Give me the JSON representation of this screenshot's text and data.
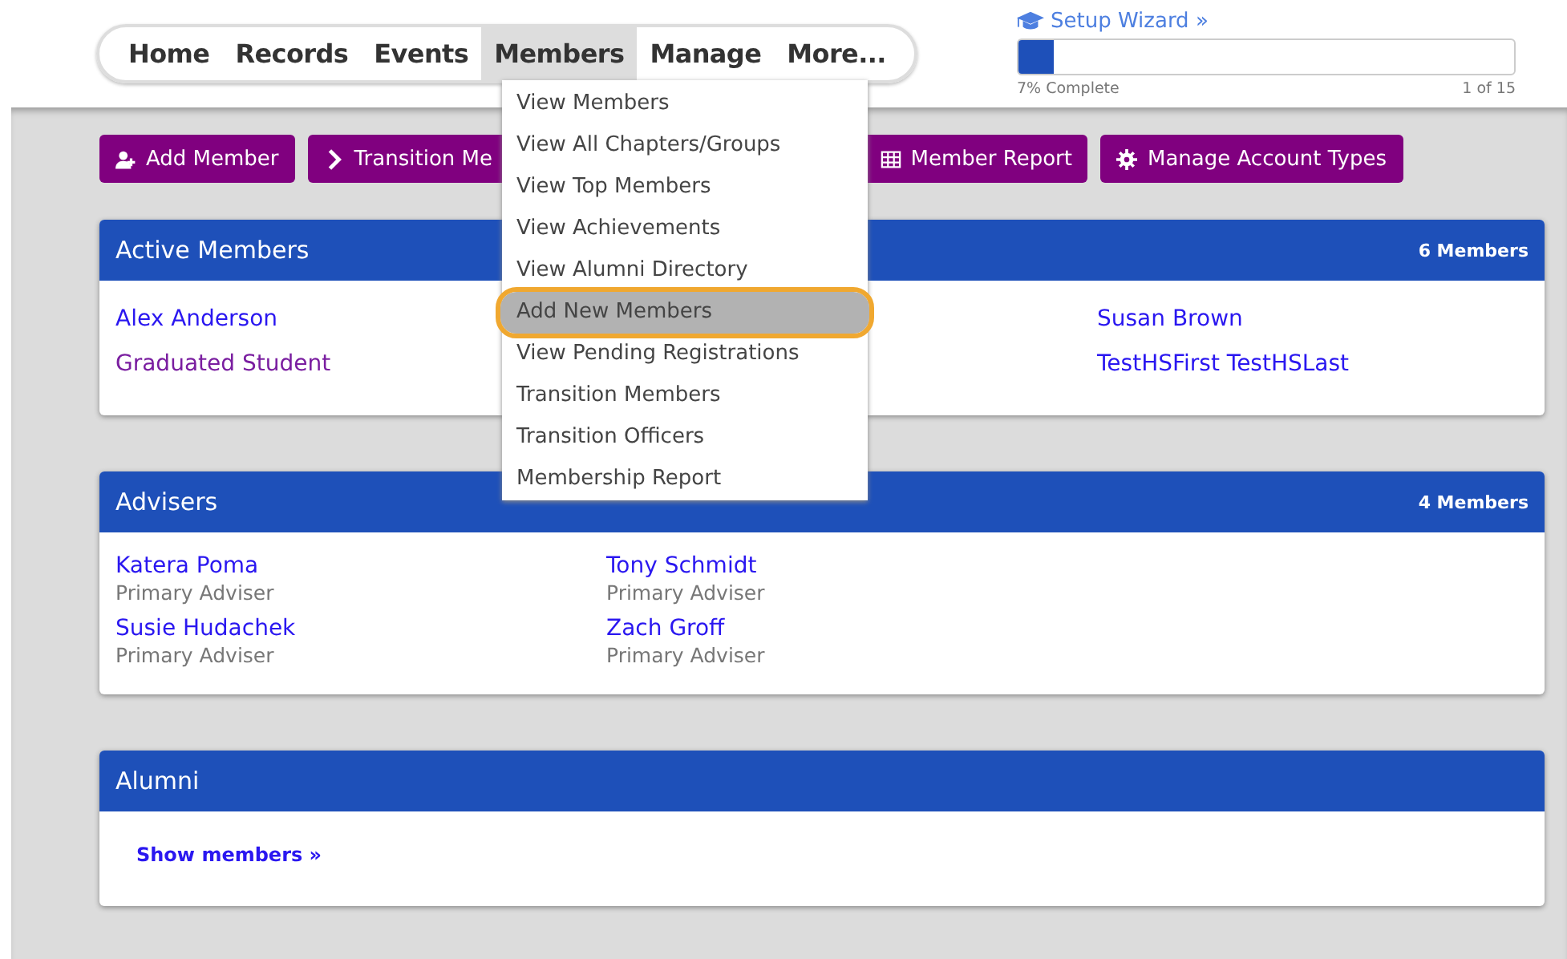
{
  "nav": {
    "tabs": [
      {
        "label": "Home",
        "selected": false
      },
      {
        "label": "Records",
        "selected": false
      },
      {
        "label": "Events",
        "selected": false
      },
      {
        "label": "Members",
        "selected": true
      },
      {
        "label": "Manage",
        "selected": false
      },
      {
        "label": "More...",
        "selected": false
      }
    ]
  },
  "setup_wizard": {
    "link": "Setup Wizard »",
    "level": 0.07,
    "percent": "7% Complete",
    "steps": "1 of 15"
  },
  "dropdown": {
    "items": [
      {
        "label": "View Members",
        "selected": false
      },
      {
        "label": "View All Chapters/Groups",
        "selected": false
      },
      {
        "label": "View Top Members",
        "selected": false
      },
      {
        "label": "View Achievements",
        "selected": false
      },
      {
        "label": "View Alumni Directory",
        "selected": false
      },
      {
        "label": "Add New Members",
        "selected": true
      },
      {
        "label": "View Pending Registrations",
        "selected": false
      },
      {
        "label": "Transition Members",
        "selected": false
      },
      {
        "label": "Transition Officers",
        "selected": false
      },
      {
        "label": "Membership Report",
        "selected": false
      }
    ]
  },
  "toolbar": [
    {
      "kind": "add",
      "label": "Add Member"
    },
    {
      "kind": "transition",
      "label": "Transition Me"
    },
    {
      "kind": "report",
      "label": "Member Report"
    },
    {
      "kind": "settings",
      "label": "Manage Account Types"
    }
  ],
  "active_members": {
    "title": "Active Members",
    "count": "6 Members",
    "columns": [
      [
        {
          "name": "Alex Anderson",
          "visited": false
        },
        {
          "name": "Graduated Student",
          "visited": true
        }
      ],
      [
        {
          "name": "Susan Brown",
          "visited": false
        },
        {
          "name": "TestHSFirst TestHSLast",
          "visited": false
        }
      ]
    ]
  },
  "advisers": {
    "title": "Advisers",
    "count": "4 Members",
    "people": [
      {
        "name": "Katera Poma",
        "role": "Primary Adviser"
      },
      {
        "name": "Tony Schmidt",
        "role": "Primary Adviser"
      },
      {
        "name": "Susie Hudachek",
        "role": "Primary Adviser"
      },
      {
        "name": "Zach Groff",
        "role": "Primary Adviser"
      }
    ]
  },
  "alumni": {
    "title": "Alumni",
    "link": "Show members »"
  }
}
